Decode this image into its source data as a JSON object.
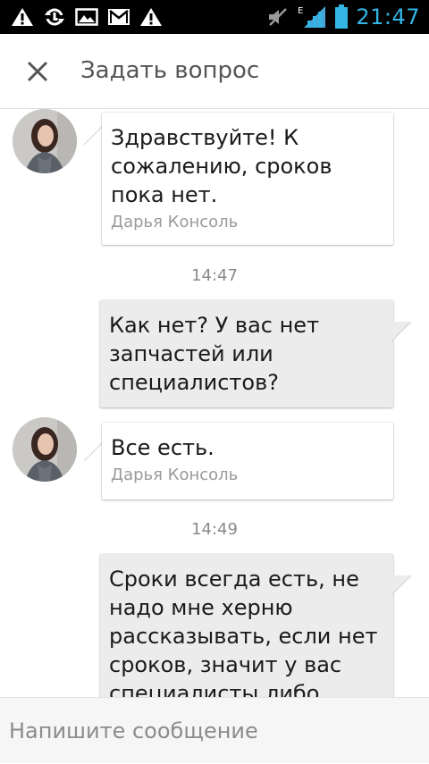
{
  "status_bar": {
    "time": "21:47",
    "network_letter": "E",
    "left_icons": [
      "warning-icon",
      "sync-icon",
      "image-icon",
      "gmail-icon",
      "warning-icon"
    ],
    "right_icons": [
      "mute-icon",
      "signal-icon",
      "battery-icon"
    ],
    "accent_color": "#33b5e5"
  },
  "header": {
    "title": "Задать вопрос",
    "close_icon": "close-icon"
  },
  "messages": [
    {
      "direction": "incoming",
      "text": "Здравствуйте! К сожалению, сроков пока нет.",
      "author": "Дарья Консоль"
    },
    {
      "timestamp": "14:47"
    },
    {
      "direction": "outgoing",
      "text": "Как нет? У вас нет запчастей или специалистов?"
    },
    {
      "direction": "incoming",
      "text": "Все есть.",
      "author": "Дарья Консоль"
    },
    {
      "timestamp": "14:49"
    },
    {
      "direction": "outgoing",
      "text": "Сроки всегда есть, не надо мне херню рассказывать, если нет сроков, значит у вас специалисты либо"
    }
  ],
  "composer": {
    "placeholder": "Напишите сообщение"
  }
}
